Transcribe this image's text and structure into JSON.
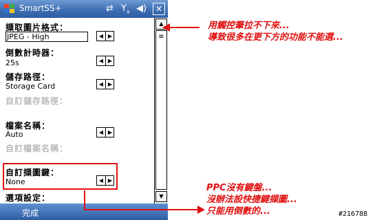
{
  "titlebar": {
    "title": "SmartSS+",
    "icons": [
      "windows-logo-icon",
      "connectivity-icon",
      "signal-off-icon",
      "volume-icon"
    ],
    "close_label": "✕"
  },
  "settings": [
    {
      "label": "擷取圖片格式：",
      "value": "JPEG - High",
      "enabled": true,
      "boxed": true,
      "spinner": true
    },
    {
      "label": "倒數計時器：",
      "value": "25s",
      "enabled": true,
      "boxed": false,
      "spinner": true
    },
    {
      "label": "儲存路徑：",
      "value": "Storage Card",
      "enabled": true,
      "boxed": false,
      "spinner": true
    },
    {
      "label": "自訂儲存路徑：",
      "value": "",
      "enabled": false,
      "boxed": false,
      "spinner": false
    },
    {
      "label": "檔案名稱：",
      "value": "Auto",
      "enabled": true,
      "boxed": false,
      "spinner": true
    },
    {
      "label": "自訂檔案名稱：",
      "value": "",
      "enabled": false,
      "boxed": false,
      "spinner": false
    },
    {
      "label": "自訂擷圖鍵：",
      "value": "None",
      "enabled": true,
      "boxed": false,
      "spinner": true
    },
    {
      "label": "選項設定：",
      "value": "",
      "enabled": true,
      "boxed": false,
      "spinner": false
    }
  ],
  "softkey": {
    "left_label": "完成"
  },
  "annotations": {
    "top_note_line1": "用觸控筆拉不下來...",
    "top_note_line2": "導致很多在更下方的功能不能選...",
    "bottom_note_line1": "PPC沒有鍵盤...",
    "bottom_note_line2": "沒辦法設快捷鍵擷圖...",
    "bottom_note_line3": "只能用倒數的..."
  },
  "watermark": "#216788",
  "colors": {
    "accent": "#3f6fb2",
    "annotation": "#e01010",
    "disabled_text": "#b9b9b9"
  }
}
